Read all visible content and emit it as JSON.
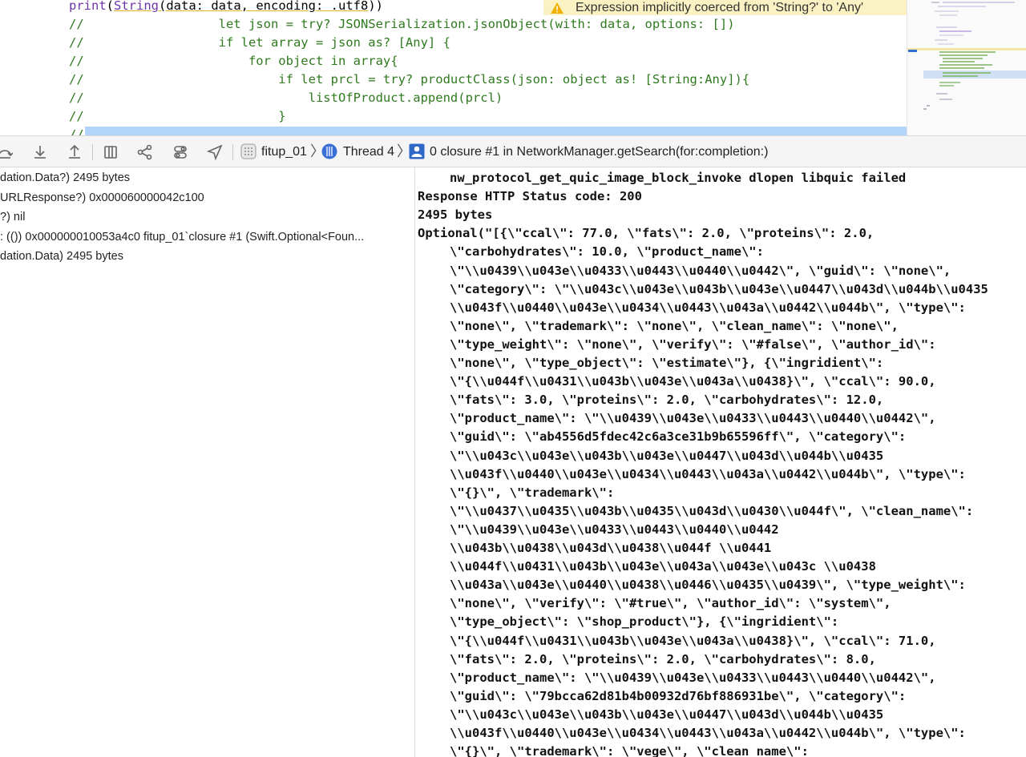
{
  "editor": {
    "lines": [
      {
        "kind": "print",
        "segments": [
          {
            "cls": "fn",
            "text": "print"
          },
          {
            "cls": "",
            "text": "("
          },
          {
            "cls": "ty",
            "text": "String"
          },
          {
            "cls": "warn-ul",
            "text": "(data: data, encoding: "
          },
          {
            "cls": "warn-ul",
            "text": ".utf8"
          },
          {
            "cls": "",
            "text": "))"
          }
        ]
      },
      {
        "kind": "comment",
        "text": "//                  let json = try? JSONSerialization.jsonObject(with: data, options: [])"
      },
      {
        "kind": "comment",
        "text": "//                  if let array = json as? [Any] {"
      },
      {
        "kind": "comment",
        "text": "//                      for object in array{"
      },
      {
        "kind": "comment",
        "text": "//                          if let prcl = try? productClass(json: object as! [String:Any]){"
      },
      {
        "kind": "comment",
        "text": "//                              listOfProduct.append(prcl)"
      },
      {
        "kind": "comment",
        "text": "//                          }"
      },
      {
        "kind": "comment",
        "text": "//"
      }
    ],
    "warning": {
      "icon": "warning-triangle-icon",
      "text": "Expression implicitly coerced from 'String?' to 'Any'"
    }
  },
  "debug_bar": {
    "buttons": [
      {
        "name": "step-over-icon"
      },
      {
        "name": "step-into-icon"
      },
      {
        "name": "step-out-icon"
      },
      {
        "name": "view-hierarchy-icon"
      },
      {
        "name": "memory-graph-icon"
      },
      {
        "name": "environment-overrides-icon"
      },
      {
        "name": "simulate-location-icon"
      }
    ],
    "breadcrumb": {
      "app": "fitup_01",
      "thread": "Thread 4",
      "frame": "0 closure #1 in NetworkManager.getSearch(for:completion:)"
    }
  },
  "variables": [
    "dation.Data?) 2495 bytes",
    "URLResponse?) 0x000060000042c100",
    "?) nil",
    ": (()) 0x000000010053a4c0 fitup_01`closure #1 (Swift.Optional<Foun...",
    "dation.Data) 2495 bytes"
  ],
  "console": {
    "lines": [
      {
        "indent": true,
        "text": "nw_protocol_get_quic_image_block_invoke dlopen libquic failed"
      },
      {
        "indent": false,
        "text": "Response HTTP Status code: 200"
      },
      {
        "indent": false,
        "text": "2495 bytes"
      },
      {
        "indent": false,
        "text": "Optional(\"[{\\\"ccal\\\": 77.0, \\\"fats\\\": 2.0, \\\"proteins\\\": 2.0,"
      },
      {
        "indent": true,
        "text": "\\\"carbohydrates\\\": 10.0, \\\"product_name\\\":"
      },
      {
        "indent": true,
        "text": "\\\"\\\\u0439\\\\u043e\\\\u0433\\\\u0443\\\\u0440\\\\u0442\\\", \\\"guid\\\": \\\"none\\\","
      },
      {
        "indent": true,
        "text": "\\\"category\\\": \\\"\\\\u043c\\\\u043e\\\\u043b\\\\u043e\\\\u0447\\\\u043d\\\\u044b\\\\u0435"
      },
      {
        "indent": true,
        "text": "\\\\u043f\\\\u0440\\\\u043e\\\\u0434\\\\u0443\\\\u043a\\\\u0442\\\\u044b\\\", \\\"type\\\":"
      },
      {
        "indent": true,
        "text": "\\\"none\\\", \\\"trademark\\\": \\\"none\\\", \\\"clean_name\\\": \\\"none\\\","
      },
      {
        "indent": true,
        "text": "\\\"type_weight\\\": \\\"none\\\", \\\"verify\\\": \\\"#false\\\", \\\"author_id\\\":"
      },
      {
        "indent": true,
        "text": "\\\"none\\\", \\\"type_object\\\": \\\"estimate\\\"}, {\\\"ingridient\\\":"
      },
      {
        "indent": true,
        "text": "\\\"{\\\\u044f\\\\u0431\\\\u043b\\\\u043e\\\\u043a\\\\u0438}\\\", \\\"ccal\\\": 90.0,"
      },
      {
        "indent": true,
        "text": "\\\"fats\\\": 3.0, \\\"proteins\\\": 2.0, \\\"carbohydrates\\\": 12.0,"
      },
      {
        "indent": true,
        "text": "\\\"product_name\\\": \\\"\\\\u0439\\\\u043e\\\\u0433\\\\u0443\\\\u0440\\\\u0442\\\","
      },
      {
        "indent": true,
        "text": "\\\"guid\\\": \\\"ab4556d5fdec42c6a3ce31b9b65596ff\\\", \\\"category\\\":"
      },
      {
        "indent": true,
        "text": "\\\"\\\\u043c\\\\u043e\\\\u043b\\\\u043e\\\\u0447\\\\u043d\\\\u044b\\\\u0435"
      },
      {
        "indent": true,
        "text": "\\\\u043f\\\\u0440\\\\u043e\\\\u0434\\\\u0443\\\\u043a\\\\u0442\\\\u044b\\\", \\\"type\\\":"
      },
      {
        "indent": true,
        "text": "\\\"{}\\\", \\\"trademark\\\":"
      },
      {
        "indent": true,
        "text": "\\\"\\\\u0437\\\\u0435\\\\u043b\\\\u0435\\\\u043d\\\\u0430\\\\u044f\\\", \\\"clean_name\\\":"
      },
      {
        "indent": true,
        "text": "\\\"\\\\u0439\\\\u043e\\\\u0433\\\\u0443\\\\u0440\\\\u0442"
      },
      {
        "indent": true,
        "text": "\\\\u043b\\\\u0438\\\\u043d\\\\u0438\\\\u044f \\\\u0441"
      },
      {
        "indent": true,
        "text": "\\\\u044f\\\\u0431\\\\u043b\\\\u043e\\\\u043a\\\\u043e\\\\u043c \\\\u0438"
      },
      {
        "indent": true,
        "text": "\\\\u043a\\\\u043e\\\\u0440\\\\u0438\\\\u0446\\\\u0435\\\\u0439\\\", \\\"type_weight\\\":"
      },
      {
        "indent": true,
        "text": "\\\"none\\\", \\\"verify\\\": \\\"#true\\\", \\\"author_id\\\": \\\"system\\\","
      },
      {
        "indent": true,
        "text": "\\\"type_object\\\": \\\"shop_product\\\"}, {\\\"ingridient\\\":"
      },
      {
        "indent": true,
        "text": "\\\"{\\\\u044f\\\\u0431\\\\u043b\\\\u043e\\\\u043a\\\\u0438}\\\", \\\"ccal\\\": 71.0,"
      },
      {
        "indent": true,
        "text": "\\\"fats\\\": 2.0, \\\"proteins\\\": 2.0, \\\"carbohydrates\\\": 8.0,"
      },
      {
        "indent": true,
        "text": "\\\"product_name\\\": \\\"\\\\u0439\\\\u043e\\\\u0433\\\\u0443\\\\u0440\\\\u0442\\\","
      },
      {
        "indent": true,
        "text": "\\\"guid\\\": \\\"79bcca62d81b4b00932d76bf886931be\\\", \\\"category\\\":"
      },
      {
        "indent": true,
        "text": "\\\"\\\\u043c\\\\u043e\\\\u043b\\\\u043e\\\\u0447\\\\u043d\\\\u044b\\\\u0435"
      },
      {
        "indent": true,
        "text": "\\\\u043f\\\\u0440\\\\u043e\\\\u0434\\\\u0443\\\\u043a\\\\u0442\\\\u044b\\\", \\\"type\\\":"
      },
      {
        "indent": true,
        "text": "\\\"{}\\\", \\\"trademark\\\": \\\"vege\\\", \\\"clean_name\\\":"
      }
    ]
  }
}
